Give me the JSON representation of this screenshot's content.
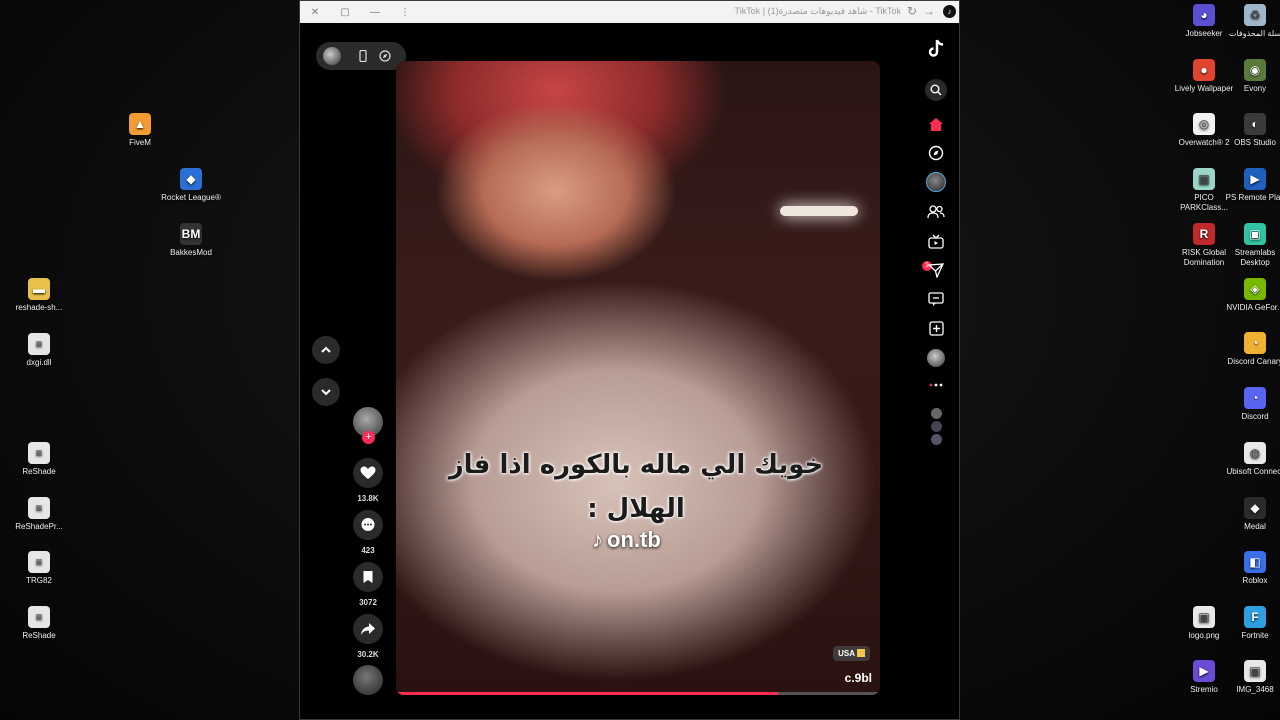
{
  "desktop": {
    "left_icons": [
      {
        "label": "FiveM",
        "icon": "fivem-icon",
        "color": "#f39c33",
        "glyph": "▲"
      },
      {
        "label": "Rocket League®",
        "icon": "rocket-league-icon",
        "color": "#2b6fd6",
        "glyph": "◆"
      },
      {
        "label": "BakkesMod",
        "icon": "bakkesmod-icon",
        "color": "#333333",
        "glyph": "BM"
      },
      {
        "label": "reshade-sh...",
        "icon": "folder-icon",
        "color": "#e8c14a",
        "glyph": "▬"
      },
      {
        "label": "dxgi.dll",
        "icon": "file-icon",
        "color": "#e6e6e6",
        "glyph": "≡"
      },
      {
        "label": "ReShade",
        "icon": "file-icon",
        "color": "#e6e6e6",
        "glyph": "≡"
      },
      {
        "label": "ReShadePr...",
        "icon": "file-icon",
        "color": "#e6e6e6",
        "glyph": "≡"
      },
      {
        "label": "TRG82",
        "icon": "file-icon",
        "color": "#e6e6e6",
        "glyph": "≡"
      },
      {
        "label": "ReShade",
        "icon": "file-icon",
        "color": "#e6e6e6",
        "glyph": "≡"
      }
    ],
    "right_icons": [
      {
        "label": "Jobseeker",
        "icon": "jobseeker-icon",
        "color": "#5a4fcf",
        "glyph": "◕"
      },
      {
        "label": "سلة المحذوفات",
        "icon": "recycle-bin-icon",
        "color": "#9fb7c9",
        "glyph": "♻"
      },
      {
        "label": "Lively Wallpaper",
        "icon": "lively-wallpaper-icon",
        "color": "#e0452f",
        "glyph": "●"
      },
      {
        "label": "Evony",
        "icon": "evony-icon",
        "color": "#5a7a3b",
        "glyph": "◉"
      },
      {
        "label": "Overwatch® 2",
        "icon": "overwatch-icon",
        "color": "#f2f2f2",
        "glyph": "◎"
      },
      {
        "label": "OBS Studio",
        "icon": "obs-icon",
        "color": "#3a3a3a",
        "glyph": "◐"
      },
      {
        "label": "PICO PARKClass...",
        "icon": "pico-park-icon",
        "color": "#9ad6c8",
        "glyph": "▦"
      },
      {
        "label": "PS Remote Play",
        "icon": "ps-remote-play-icon",
        "color": "#1f5fbf",
        "glyph": "▶"
      },
      {
        "label": "RISK Global Domination",
        "icon": "risk-icon",
        "color": "#c02a2a",
        "glyph": "R"
      },
      {
        "label": "Streamlabs Desktop",
        "icon": "streamlabs-icon",
        "color": "#31c3a2",
        "glyph": "▣"
      },
      {
        "label": "NVIDIA GeFor...",
        "icon": "nvidia-icon",
        "color": "#76b900",
        "glyph": "◈"
      },
      {
        "label": "Discord Canary",
        "icon": "discord-canary-icon",
        "color": "#f0b232",
        "glyph": "◔"
      },
      {
        "label": "Discord",
        "icon": "discord-icon",
        "color": "#5865f2",
        "glyph": "◔"
      },
      {
        "label": "Ubisoft Connect",
        "icon": "ubisoft-icon",
        "color": "#e9e9e9",
        "glyph": "◍"
      },
      {
        "label": "Medal",
        "icon": "medal-icon",
        "color": "#2b2b2b",
        "glyph": "◆"
      },
      {
        "label": "Roblox",
        "icon": "roblox-icon",
        "color": "#3a6fe8",
        "glyph": "◧"
      },
      {
        "label": "logo.png",
        "icon": "image-file-icon",
        "color": "#e8e8e8",
        "glyph": "▣"
      },
      {
        "label": "Fortnite",
        "icon": "fortnite-icon",
        "color": "#2f9fe3",
        "glyph": "F"
      },
      {
        "label": "Stremio",
        "icon": "stremio-icon",
        "color": "#6a4bd6",
        "glyph": "▶"
      },
      {
        "label": "IMG_3468",
        "icon": "image-file-icon",
        "color": "#e8e8e8",
        "glyph": "▣"
      }
    ]
  },
  "window": {
    "title": "TikTok | شاهد فيديوهات متصدرة(1) - TikTok",
    "close_glyph": "✕",
    "restore_glyph": "▢",
    "minimize_glyph": "—",
    "menu_glyph": "⋮"
  },
  "video": {
    "caption": "خويك الي ماله بالكوره اذا فاز الهلال :",
    "watermark": "on.tb",
    "region_badge": "USA",
    "handle": "c.9bl",
    "progress": 0.79
  },
  "actions": {
    "likes": "13.8K",
    "comments": "423",
    "saves": "3072",
    "shares": "30.2K"
  },
  "sidebar": {
    "notification_count": "1"
  },
  "colors": {
    "accent": "#fe2c55"
  }
}
